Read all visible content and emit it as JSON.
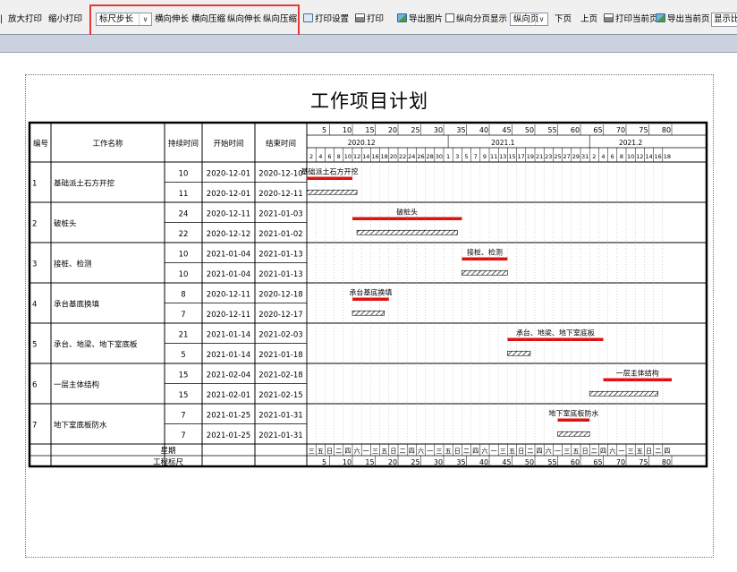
{
  "toolbar": {
    "enlarge_label": "放大打印",
    "shrink_label": "缩小打印",
    "scale_select_value": "标尺步长",
    "h_stretch_label": "横向伸长",
    "h_compress_label": "横向压缩",
    "v_stretch_label": "纵向伸长",
    "v_compress_label": "纵向压缩",
    "print_settings_label": "打印设置",
    "print_label": "打印",
    "export_image_label": "导出图片",
    "v_pagination_label": "纵向分页显示",
    "page_direction_value": "纵向页",
    "next_page_label": "下页",
    "prev_page_label": "上页",
    "print_current_label": "打印当前页",
    "export_current_label": "导出当前页",
    "display_label": "显示比"
  },
  "sheet": {
    "title": "工作项目计划",
    "headers": {
      "no": "编号",
      "name": "工作名称",
      "duration": "持续时间",
      "start": "开始时间",
      "end": "结束时间"
    },
    "footer_week_label": "星期",
    "footer_scale_label": "工程标尺",
    "scale_numbers": [
      "5",
      "10",
      "15",
      "20",
      "25",
      "30",
      "35",
      "40",
      "45",
      "50",
      "55",
      "60",
      "65",
      "70",
      "75",
      "80"
    ],
    "month_labels": [
      {
        "day": 13,
        "text": "2020.12"
      },
      {
        "day": 44,
        "text": "2021.1"
      },
      {
        "day": 72,
        "text": "2021.2"
      }
    ],
    "date_numbers": [
      "2",
      "4",
      "6",
      "8",
      "10",
      "12",
      "14",
      "16",
      "18",
      "20",
      "22",
      "24",
      "26",
      "28",
      "30",
      "1",
      "3",
      "5",
      "7",
      "9",
      "11",
      "13",
      "15",
      "17",
      "19",
      "21",
      "23",
      "25",
      "27",
      "29",
      "31",
      "2",
      "4",
      "6",
      "8",
      "10",
      "12",
      "14",
      "16",
      "18"
    ],
    "weekdays": [
      "三",
      "五",
      "日",
      "二",
      "四",
      "六",
      "一",
      "三",
      "五",
      "日",
      "二",
      "四",
      "六",
      "一",
      "三",
      "五",
      "日",
      "二",
      "四",
      "六",
      "一",
      "三",
      "五",
      "日",
      "二",
      "四",
      "六",
      "一",
      "三",
      "五",
      "日",
      "二",
      "四",
      "六",
      "一",
      "三",
      "五",
      "日",
      "二",
      "四"
    ],
    "tasks": [
      {
        "no": "1",
        "name": "基础派土石方开挖",
        "plan": {
          "duration": "10",
          "start": "2020-12-01",
          "end": "2020-12-10"
        },
        "actual": {
          "duration": "11",
          "start": "2020-12-01",
          "end": "2020-12-11"
        },
        "bar_label": "基础派土石方开挖"
      },
      {
        "no": "2",
        "name": "破桩头",
        "plan": {
          "duration": "24",
          "start": "2020-12-11",
          "end": "2021-01-03"
        },
        "actual": {
          "duration": "22",
          "start": "2020-12-12",
          "end": "2021-01-02"
        },
        "bar_label": "破桩头"
      },
      {
        "no": "3",
        "name": "接桩、检测",
        "plan": {
          "duration": "10",
          "start": "2021-01-04",
          "end": "2021-01-13"
        },
        "actual": {
          "duration": "10",
          "start": "2021-01-04",
          "end": "2021-01-13"
        },
        "bar_label": "接桩、检测"
      },
      {
        "no": "4",
        "name": "承台基底换填",
        "plan": {
          "duration": "8",
          "start": "2020-12-11",
          "end": "2020-12-18"
        },
        "actual": {
          "duration": "7",
          "start": "2020-12-11",
          "end": "2020-12-17"
        },
        "bar_label": "承台基底换填"
      },
      {
        "no": "5",
        "name": "承台、地梁、地下室底板",
        "plan": {
          "duration": "21",
          "start": "2021-01-14",
          "end": "2021-02-03"
        },
        "actual": {
          "duration": "5",
          "start": "2021-01-14",
          "end": "2021-01-18"
        },
        "bar_label": "承台、地梁、地下室底板"
      },
      {
        "no": "6",
        "name": "一层主体结构",
        "plan": {
          "duration": "15",
          "start": "2021-02-04",
          "end": "2021-02-18"
        },
        "actual": {
          "duration": "15",
          "start": "2021-02-01",
          "end": "2021-02-15"
        },
        "bar_label": "一层主体结构"
      },
      {
        "no": "7",
        "name": "地下室底板防水",
        "plan": {
          "duration": "7",
          "start": "2021-01-25",
          "end": "2021-01-31"
        },
        "actual": {
          "duration": "7",
          "start": "2021-01-25",
          "end": "2021-01-31"
        },
        "bar_label": "地下室底板防水"
      }
    ]
  },
  "colors": {
    "plan_bar": "#e01010",
    "highlight": "#e13a3a",
    "actual_bar": "#000000"
  }
}
